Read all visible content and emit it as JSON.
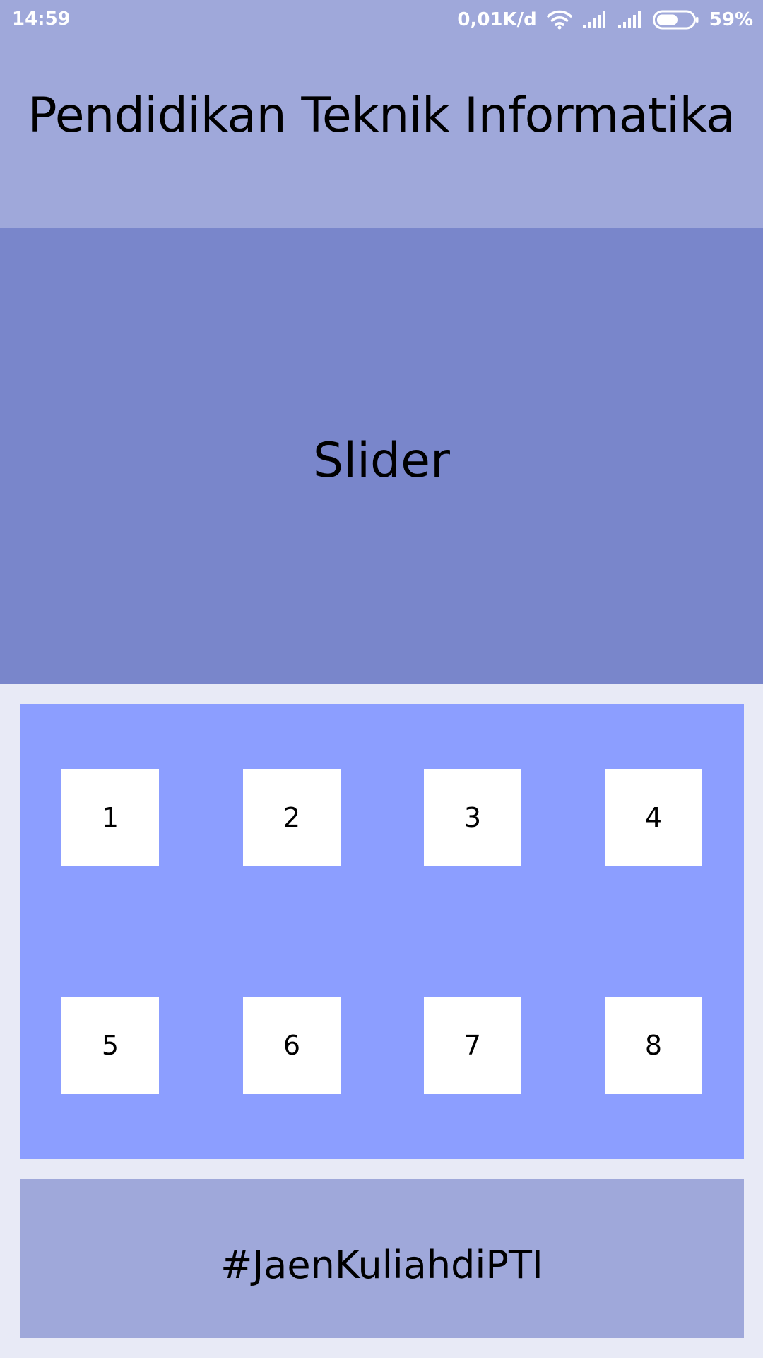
{
  "status_bar": {
    "time": "14:59",
    "network_speed": "0,01K/d",
    "battery_percent": "59%",
    "battery_level": 0.59,
    "icons": [
      "wifi-icon",
      "signal-icon",
      "signal-icon",
      "battery-icon"
    ]
  },
  "header": {
    "title": "Pendidikan Teknik Informatika"
  },
  "slider": {
    "label": "Slider"
  },
  "menu": {
    "items": [
      {
        "label": "1"
      },
      {
        "label": "2"
      },
      {
        "label": "3"
      },
      {
        "label": "4"
      },
      {
        "label": "5"
      },
      {
        "label": "6"
      },
      {
        "label": "7"
      },
      {
        "label": "8"
      }
    ]
  },
  "footer": {
    "text": "#JaenKuliahdiPTI"
  },
  "colors": {
    "header_bg": "#9FA8DA",
    "slider_bg": "#7986CB",
    "menu_bg": "#8C9EFF",
    "footer_bg": "#9FA8DA",
    "page_bg": "#E8EAF6",
    "tile_bg": "#FFFFFF"
  }
}
